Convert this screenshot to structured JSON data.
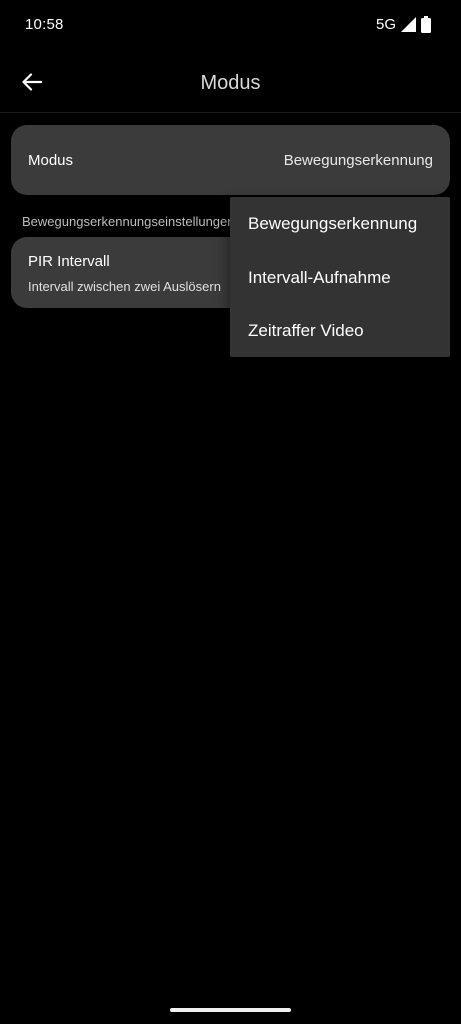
{
  "status_bar": {
    "time": "10:58",
    "network": "5G"
  },
  "app_bar": {
    "title": "Modus",
    "back_icon": "arrow-left-icon"
  },
  "mode_setting": {
    "label": "Modus",
    "value": "Bewegungserkennung"
  },
  "section": {
    "header": "Bewegungserkennungseinstellungen"
  },
  "pir_interval": {
    "title": "PIR Intervall",
    "subtitle": "Intervall zwischen zwei Auslösern"
  },
  "dropdown": {
    "items": [
      {
        "label": "Bewegungserkennung"
      },
      {
        "label": "Intervall-Aufnahme"
      },
      {
        "label": "Zeitraffer Video"
      }
    ]
  },
  "colors": {
    "background": "#000000",
    "card": "#3b3b3b",
    "menu": "#333333",
    "text": "#ffffff"
  }
}
